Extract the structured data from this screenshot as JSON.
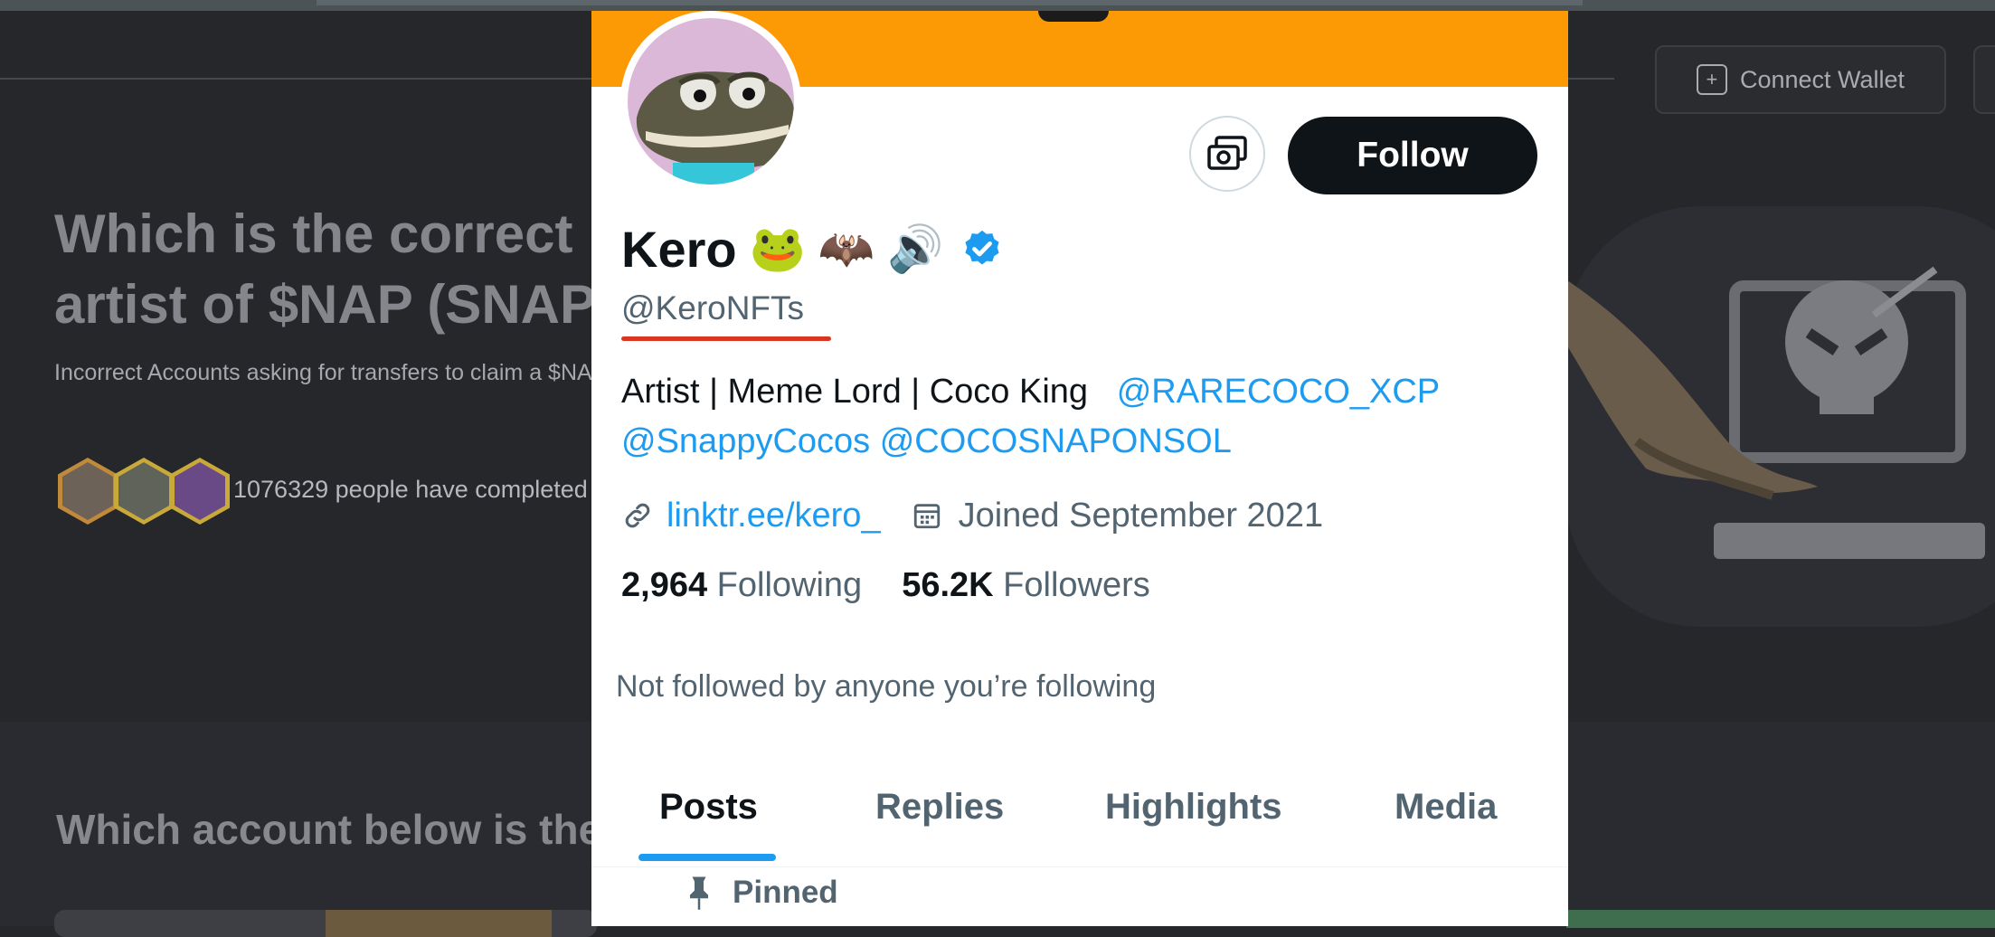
{
  "background": {
    "header_button": {
      "label": "Connect Wallet"
    },
    "question_title": "Which is the correct\nartist of $NAP (SNAP)",
    "warning_text": "Incorrect Accounts asking for transfers to claim a $NAP",
    "completed_text": "1076329 people have completed",
    "question2_title": "Which account below is the"
  },
  "profile": {
    "name": "Kero",
    "emojis": [
      "🐸",
      "🦇",
      "🔊"
    ],
    "handle": "@KeroNFTs",
    "follow_label": "Follow",
    "bio_text": "Artist | Meme Lord  | Coco King",
    "bio_mentions": [
      "@RARECOCO_XCP",
      "@SnappyCocos",
      "@COCOSNAPONSOL"
    ],
    "website": "linktr.ee/kero_",
    "joined": "Joined September 2021",
    "following_count": "2,964",
    "following_label": "Following",
    "followers_count": "56.2K",
    "followers_label": "Followers",
    "not_followed": "Not followed by anyone you’re following",
    "tabs": [
      "Posts",
      "Replies",
      "Highlights",
      "Media"
    ],
    "active_tab": "Posts",
    "pinned_label": "Pinned"
  },
  "colors": {
    "banner": "#fc9a05",
    "link": "#1d9bf0",
    "underline_annotation": "#d8361e",
    "page_bg": "#26272b"
  },
  "icons": [
    "plus-square-icon",
    "tip-jar-icon",
    "verified-badge-icon",
    "link-icon",
    "calendar-icon",
    "pin-icon"
  ]
}
